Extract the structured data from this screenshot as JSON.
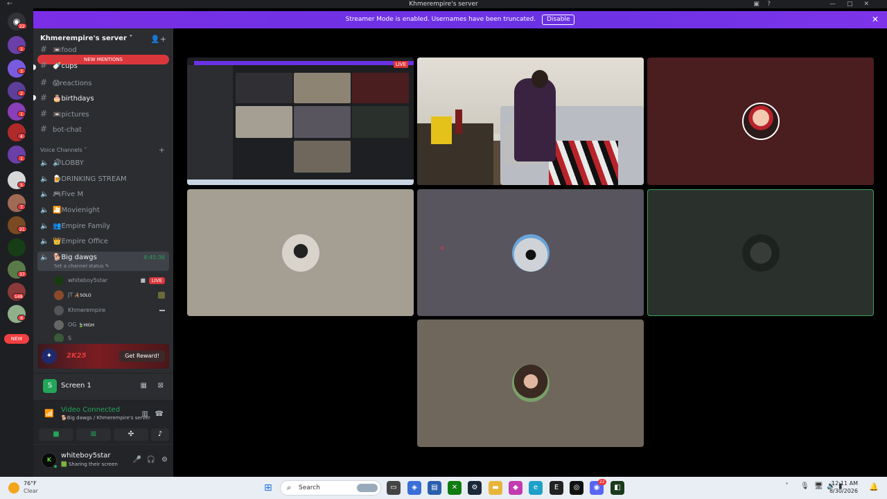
{
  "window": {
    "title": "Khmerempire's server",
    "nav_icon": "←"
  },
  "banner": {
    "text": "Streamer Mode is enabled. Usernames have been truncated.",
    "disable_label": "Disable",
    "close_glyph": "✕"
  },
  "rail": {
    "home_badge": "22",
    "badges": [
      "1",
      "3",
      "2",
      "1",
      "4",
      "1",
      "5",
      "7",
      "21",
      "37",
      "149",
      "8"
    ],
    "new_label": "NEW"
  },
  "server": {
    "name": "Khmerempire's server ˅",
    "new_mentions": "NEW MENTIONS"
  },
  "text_channels": [
    {
      "label": "📼food",
      "unread": false
    },
    {
      "label": "🍼cups",
      "unread": true
    },
    {
      "label": "😱reactions",
      "unread": false
    },
    {
      "label": "🎂birthdays",
      "unread": true
    },
    {
      "label": "📼pictures",
      "unread": false
    },
    {
      "label": "bot-chat",
      "unread": false
    }
  ],
  "voice_header": "Voice Channels ˅",
  "voice_channels": [
    {
      "label": "🔊LOBBY"
    },
    {
      "label": "🍺DRINKING STREAM"
    },
    {
      "label": "🎮Five M"
    },
    {
      "label": "🎦Movienight"
    },
    {
      "label": "👥Empire Family"
    },
    {
      "label": "👑Empire Office"
    }
  ],
  "active_voice": {
    "label": "🐕Big dawgs",
    "timer": "4:45:36",
    "status": "Set a channel status ✎"
  },
  "members": [
    {
      "name": "whiteboy5star",
      "tag": "",
      "live": "LIVE"
    },
    {
      "name": "JT",
      "tag": "🦂SOLO",
      "live": ""
    },
    {
      "name": "Khmerempire",
      "tag": "",
      "live": ""
    },
    {
      "name": "OG",
      "tag": "🍃HIGH",
      "live": ""
    },
    {
      "name": "S",
      "tag": "",
      "live": ""
    }
  ],
  "promo": {
    "logo": "2K25",
    "button": "Get Reward!"
  },
  "screen_panel": {
    "icon_letter": "S",
    "label": "Screen 1"
  },
  "rtc": {
    "status": "Video Connected",
    "location": "🐕Big dawgs / Khmerempire's server"
  },
  "user": {
    "avatar_text": "K",
    "name": "whiteboy5star",
    "status": "🟩 Sharing their screen"
  },
  "stream_preview": {
    "live": "LIVE"
  },
  "taskbar": {
    "temp": "76°F",
    "condition": "Clear",
    "search_placeholder": "Search",
    "time": "12:11 AM",
    "date": "8/30/2026",
    "discord_badge": "22"
  },
  "colors": {
    "accent": "#5865f2",
    "banner": "#6a32e3",
    "live": "#da373c",
    "speaking": "#3ba55c",
    "tile_maroon": "#4a1d1f",
    "tile_beige": "#a59f93",
    "tile_slate": "#58555e",
    "tile_darkgreen": "#2a302c",
    "tile_taupe": "#6f675c"
  }
}
